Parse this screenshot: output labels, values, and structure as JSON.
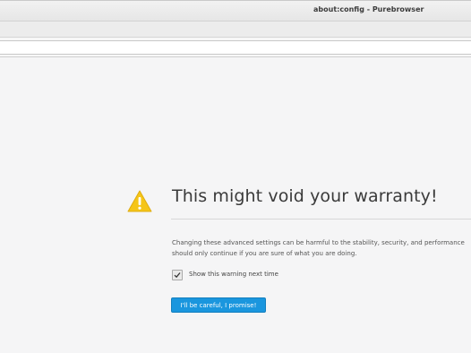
{
  "window": {
    "title": "about:config - Purebrowser"
  },
  "warning": {
    "icon": "warning-triangle-icon",
    "icon_color": "#f5c518",
    "title": "This might void your warranty!",
    "description_line1": "Changing these advanced settings can be harmful to the stability, security, and performance",
    "description_line2": "should only continue if you are sure of what you are doing.",
    "checkbox_label": "Show this warning next time",
    "checkbox_checked": true,
    "button_label": "I'll be careful, I promise!",
    "button_color": "#1a96de"
  }
}
